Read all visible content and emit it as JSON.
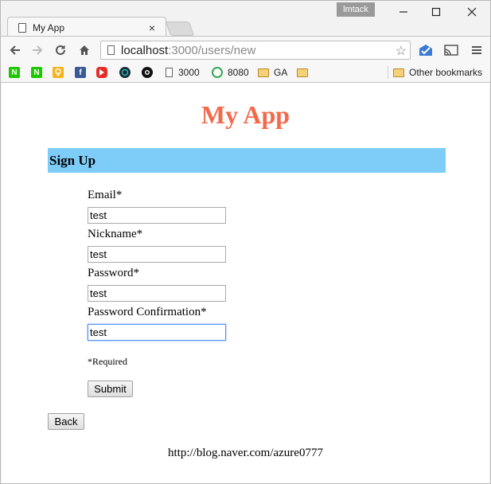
{
  "browser": {
    "tab_title": "My App",
    "tab_close": "×",
    "profile_name": "lmtack",
    "window_controls": {
      "minimize": "—",
      "maximize": "☐",
      "close": "✕"
    },
    "url_host": "localhost",
    "url_path": ":3000/users/new",
    "nav": {
      "back": "←",
      "forward": "→",
      "reload": "↻",
      "home": "⌂"
    },
    "star": "☆",
    "menu": "≡"
  },
  "bookmarks": {
    "items": [
      {
        "label": "",
        "icon": "naver-n-icon",
        "color": "#1ec800"
      },
      {
        "label": "",
        "icon": "naver-n-icon",
        "color": "#1ec800"
      },
      {
        "label": "",
        "icon": "lightbulb-icon",
        "color": "#f6b31b"
      },
      {
        "label": "",
        "icon": "facebook-icon",
        "color": "#3b5998"
      },
      {
        "label": "",
        "icon": "youtube-icon",
        "color": "#e52d27"
      },
      {
        "label": "",
        "icon": "dark-app-icon",
        "color": "#1a2b36"
      },
      {
        "label": "",
        "icon": "github-icon",
        "color": "#111111"
      },
      {
        "label": "3000",
        "icon": "page-icon"
      },
      {
        "label": "8080",
        "icon": "green-q-icon",
        "color": "#34a853"
      },
      {
        "label": "GA",
        "icon": "folder-icon"
      },
      {
        "label": "",
        "icon": "folder-icon"
      }
    ],
    "other": "Other bookmarks"
  },
  "page": {
    "title": "My App",
    "section_heading": "Sign Up",
    "fields": [
      {
        "label": "Email*",
        "value": "test"
      },
      {
        "label": "Nickname*",
        "value": "test"
      },
      {
        "label": "Password*",
        "value": "test"
      },
      {
        "label": "Password Confirmation*",
        "value": "test"
      }
    ],
    "required_note": "*Required",
    "submit_label": "Submit",
    "back_label": "Back",
    "footer_text": "http://blog.naver.com/azure0777"
  },
  "colors": {
    "title": "#f4694a",
    "section_bg": "#7dcdf8",
    "focus": "#4d90fe"
  }
}
